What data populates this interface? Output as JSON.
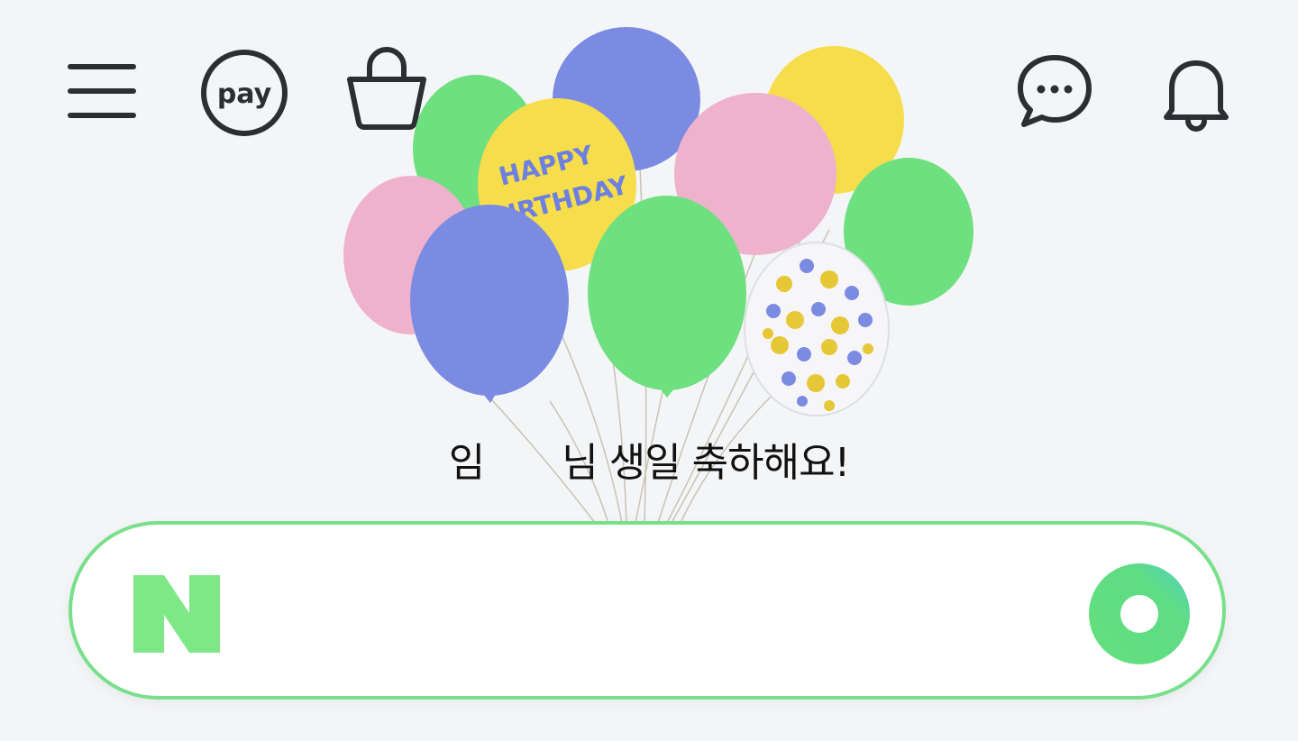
{
  "header": {
    "left_icons": [
      "menu-icon",
      "pay-icon",
      "shopping-bag-icon"
    ],
    "right_icons": [
      "chat-icon",
      "bell-icon"
    ],
    "pay_label": "pay"
  },
  "greeting": {
    "prefix": "임",
    "suffix": "님 생일 축하해요!"
  },
  "balloon": {
    "text_line1": "HAPPY",
    "text_line2": "BIRTHDAY"
  },
  "search": {
    "logo_letter": "N",
    "value": "",
    "placeholder": ""
  },
  "colors": {
    "accent_green": "#78e08a",
    "logo_green": "#7ee887",
    "background": "#f4f5f7",
    "balloon_green": "#6ee07f",
    "balloon_blue": "#7b8be2",
    "balloon_yellow": "#f5dd4c",
    "balloon_pink": "#eeb2cc"
  }
}
